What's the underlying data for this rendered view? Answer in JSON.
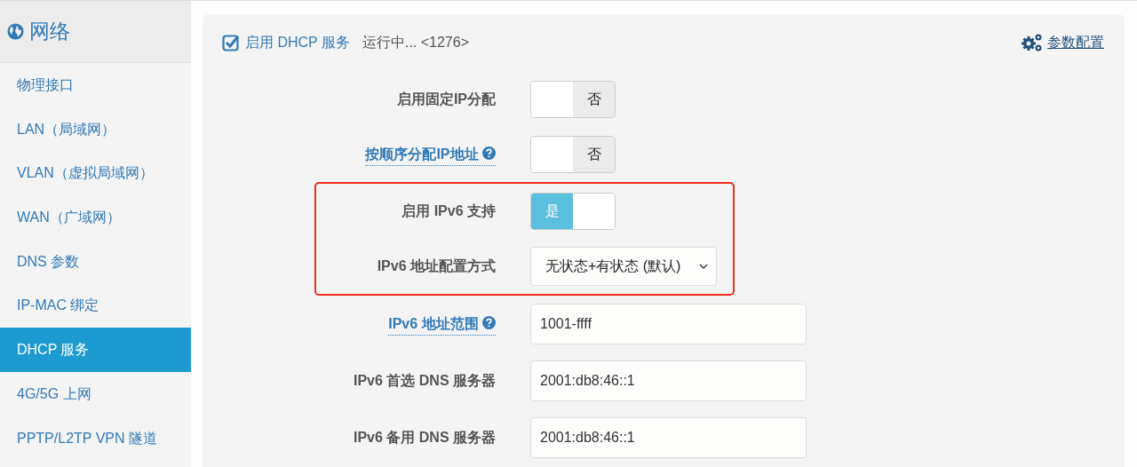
{
  "sidebar": {
    "title": "网络",
    "items": [
      {
        "label": "物理接口",
        "selected": false
      },
      {
        "label": "LAN（局域网）",
        "selected": false
      },
      {
        "label": "VLAN（虚拟局域网）",
        "selected": false
      },
      {
        "label": "WAN（广域网）",
        "selected": false
      },
      {
        "label": "DNS 参数",
        "selected": false
      },
      {
        "label": "IP-MAC 绑定",
        "selected": false
      },
      {
        "label": "DHCP 服务",
        "selected": true
      },
      {
        "label": "4G/5G 上网",
        "selected": false
      },
      {
        "label": "PPTP/L2TP VPN 隧道",
        "selected": false
      }
    ]
  },
  "panel": {
    "service": {
      "label": "启用 DHCP 服务",
      "checked": true
    },
    "status": "运行中... <1276>",
    "settings_link": "参数配置",
    "fields": [
      {
        "kind": "toggle",
        "label": "启用固定IP分配",
        "help": false,
        "highlighted": false,
        "on": false,
        "text": "否"
      },
      {
        "kind": "toggle",
        "label": "按顺序分配IP地址",
        "help": true,
        "highlighted": false,
        "on": false,
        "text": "否"
      },
      {
        "kind": "toggle",
        "label": "启用 IPv6 支持",
        "help": false,
        "highlighted": true,
        "on": true,
        "text": "是"
      },
      {
        "kind": "select",
        "label": "IPv6 地址配置方式",
        "help": false,
        "highlighted": true,
        "value": "无状态+有状态 (默认)"
      },
      {
        "kind": "text",
        "label": "IPv6 地址范围",
        "help": true,
        "highlighted": false,
        "value": "1001-ffff"
      },
      {
        "kind": "text",
        "label": "IPv6 首选 DNS 服务器",
        "help": false,
        "highlighted": false,
        "value": "2001:db8:46::1"
      },
      {
        "kind": "text",
        "label": "IPv6 备用 DNS 服务器",
        "help": false,
        "highlighted": false,
        "value": "2001:db8:46::1"
      }
    ]
  }
}
